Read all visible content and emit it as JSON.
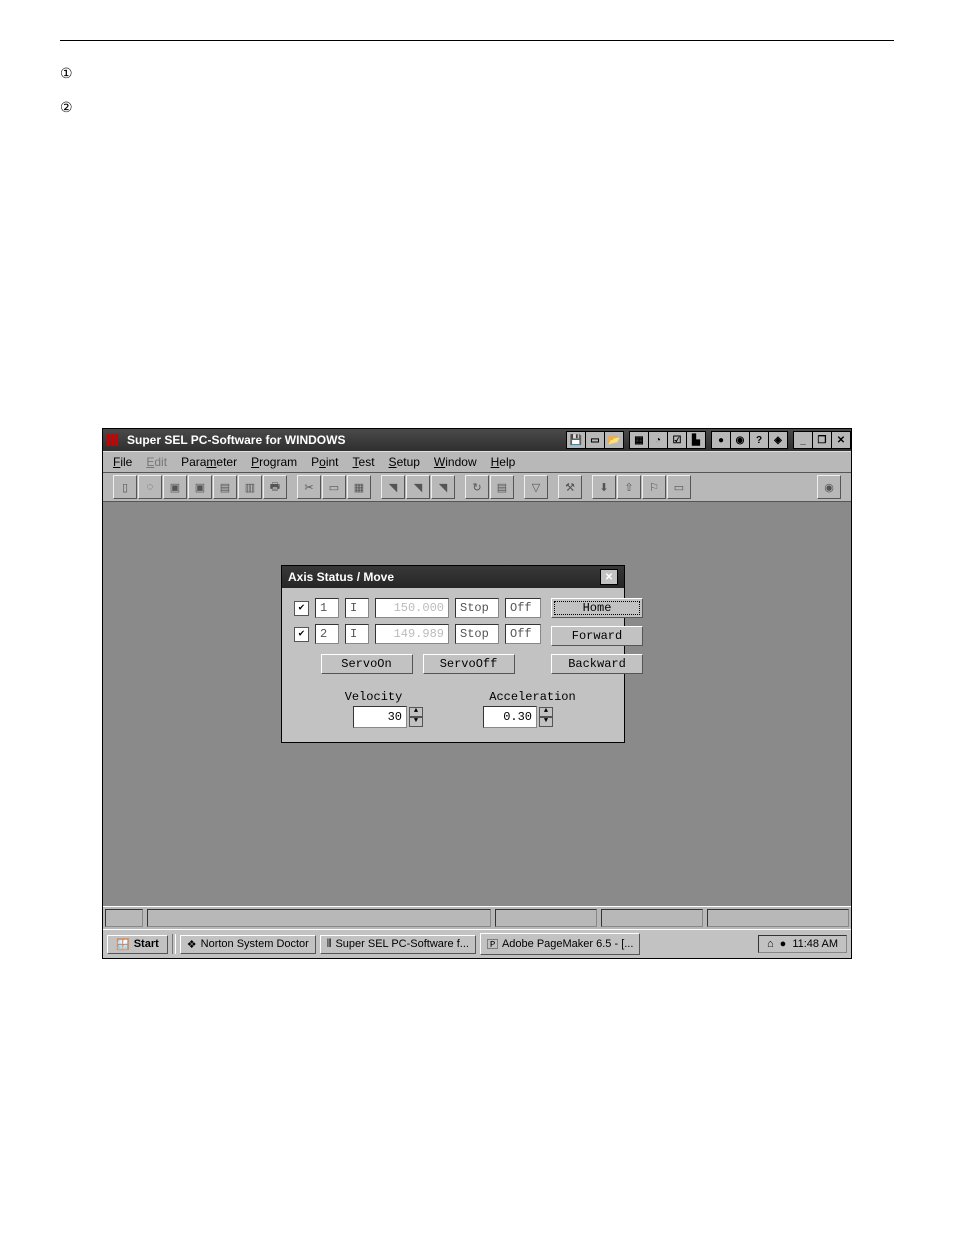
{
  "doc": {
    "bullet1": "①",
    "bullet2": "②"
  },
  "app": {
    "title": "Super SEL PC-Software for WINDOWS",
    "menus": {
      "file": "File",
      "edit": "Edit",
      "param": "Parameter",
      "prog": "Program",
      "point": "Point",
      "test": "Test",
      "setup": "Setup",
      "window": "Window",
      "help": "Help"
    }
  },
  "dialog": {
    "title": "Axis Status / Move",
    "rows": [
      {
        "checked": true,
        "axis": "1",
        "i": "I",
        "pos": "150.000",
        "state": "Stop",
        "servo": "Off"
      },
      {
        "checked": true,
        "axis": "2",
        "i": "I",
        "pos": "149.989",
        "state": "Stop",
        "servo": "Off"
      }
    ],
    "buttons": {
      "home": "Home",
      "forward": "Forward",
      "backward": "Backward",
      "servoOn": "ServoOn",
      "servoOff": "ServoOff"
    },
    "labels": {
      "velocity": "Velocity",
      "acceleration": "Acceleration"
    },
    "values": {
      "velocity": "30",
      "acceleration": "0.30"
    }
  },
  "taskbar": {
    "start": "Start",
    "apps": [
      "Norton System Doctor",
      "Super SEL PC-Software f...",
      "Adobe PageMaker 6.5 - [..."
    ],
    "time": "11:48 AM"
  }
}
